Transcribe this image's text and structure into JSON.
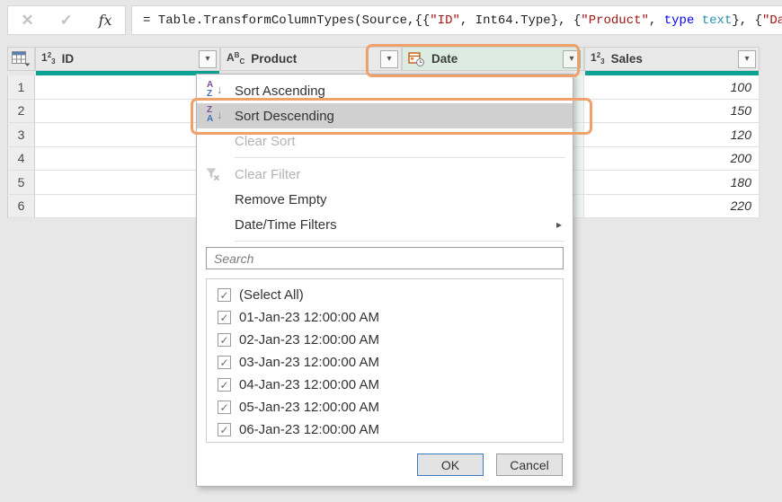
{
  "colors": {
    "accent_teal": "#0ca395",
    "annotation_orange": "#efa16b",
    "selected_column_bg": "#ddece3",
    "menu_highlight_gray": "#d0d0d0",
    "ok_button_border": "#3a7bbf"
  },
  "icons": {
    "cancel": "✕",
    "check": "✓",
    "fx": "fx",
    "dropdown_arrow": "▾",
    "down_arrow": "↓",
    "submenu_arrow": "▸",
    "num_type": {
      "a": "1",
      "b": "2",
      "c": "3"
    },
    "text_type": {
      "a": "A",
      "b": "B",
      "c": "C"
    }
  },
  "formula_bar": {
    "segments": [
      {
        "text": "= Table.TransformColumnTypes(Source,{{",
        "color": "#1e1e1e"
      },
      {
        "text": "\"ID\"",
        "color": "#a31515"
      },
      {
        "text": ", Int64.Type}, {",
        "color": "#1e1e1e"
      },
      {
        "text": "\"Product\"",
        "color": "#a31515"
      },
      {
        "text": ", ",
        "color": "#1e1e1e"
      },
      {
        "text": "type",
        "color": "#0000ff"
      },
      {
        "text": " ",
        "color": "#1e1e1e"
      },
      {
        "text": "text",
        "color": "#2b91af"
      },
      {
        "text": "}, {",
        "color": "#1e1e1e"
      },
      {
        "text": "\"Dat",
        "color": "#a31515"
      }
    ]
  },
  "grid": {
    "columns": [
      {
        "label": "ID"
      },
      {
        "label": "Product"
      },
      {
        "label": "Date"
      },
      {
        "label": "Sales"
      }
    ],
    "rows": [
      {
        "num": "1",
        "sales": "100"
      },
      {
        "num": "2",
        "sales": "150"
      },
      {
        "num": "3",
        "sales": "120"
      },
      {
        "num": "4",
        "sales": "200"
      },
      {
        "num": "5",
        "sales": "180"
      },
      {
        "num": "6",
        "sales": "220"
      }
    ]
  },
  "menu": {
    "items": [
      {
        "label": "Sort Ascending",
        "icon_top": "A",
        "icon_bottom": "Z"
      },
      {
        "label": "Sort Descending",
        "icon_top": "Z",
        "icon_bottom": "A"
      },
      {
        "label": "Clear Sort"
      },
      {
        "label": "Clear Filter"
      },
      {
        "label": "Remove Empty"
      },
      {
        "label": "Date/Time Filters"
      }
    ],
    "search_placeholder": "Search",
    "filter_list": [
      {
        "label": "(Select All)",
        "checked": true
      },
      {
        "label": "01-Jan-23 12:00:00 AM",
        "checked": true
      },
      {
        "label": "02-Jan-23 12:00:00 AM",
        "checked": true
      },
      {
        "label": "03-Jan-23 12:00:00 AM",
        "checked": true
      },
      {
        "label": "04-Jan-23 12:00:00 AM",
        "checked": true
      },
      {
        "label": "05-Jan-23 12:00:00 AM",
        "checked": true
      },
      {
        "label": "06-Jan-23 12:00:00 AM",
        "checked": true
      }
    ],
    "ok_label": "OK",
    "cancel_label": "Cancel"
  }
}
